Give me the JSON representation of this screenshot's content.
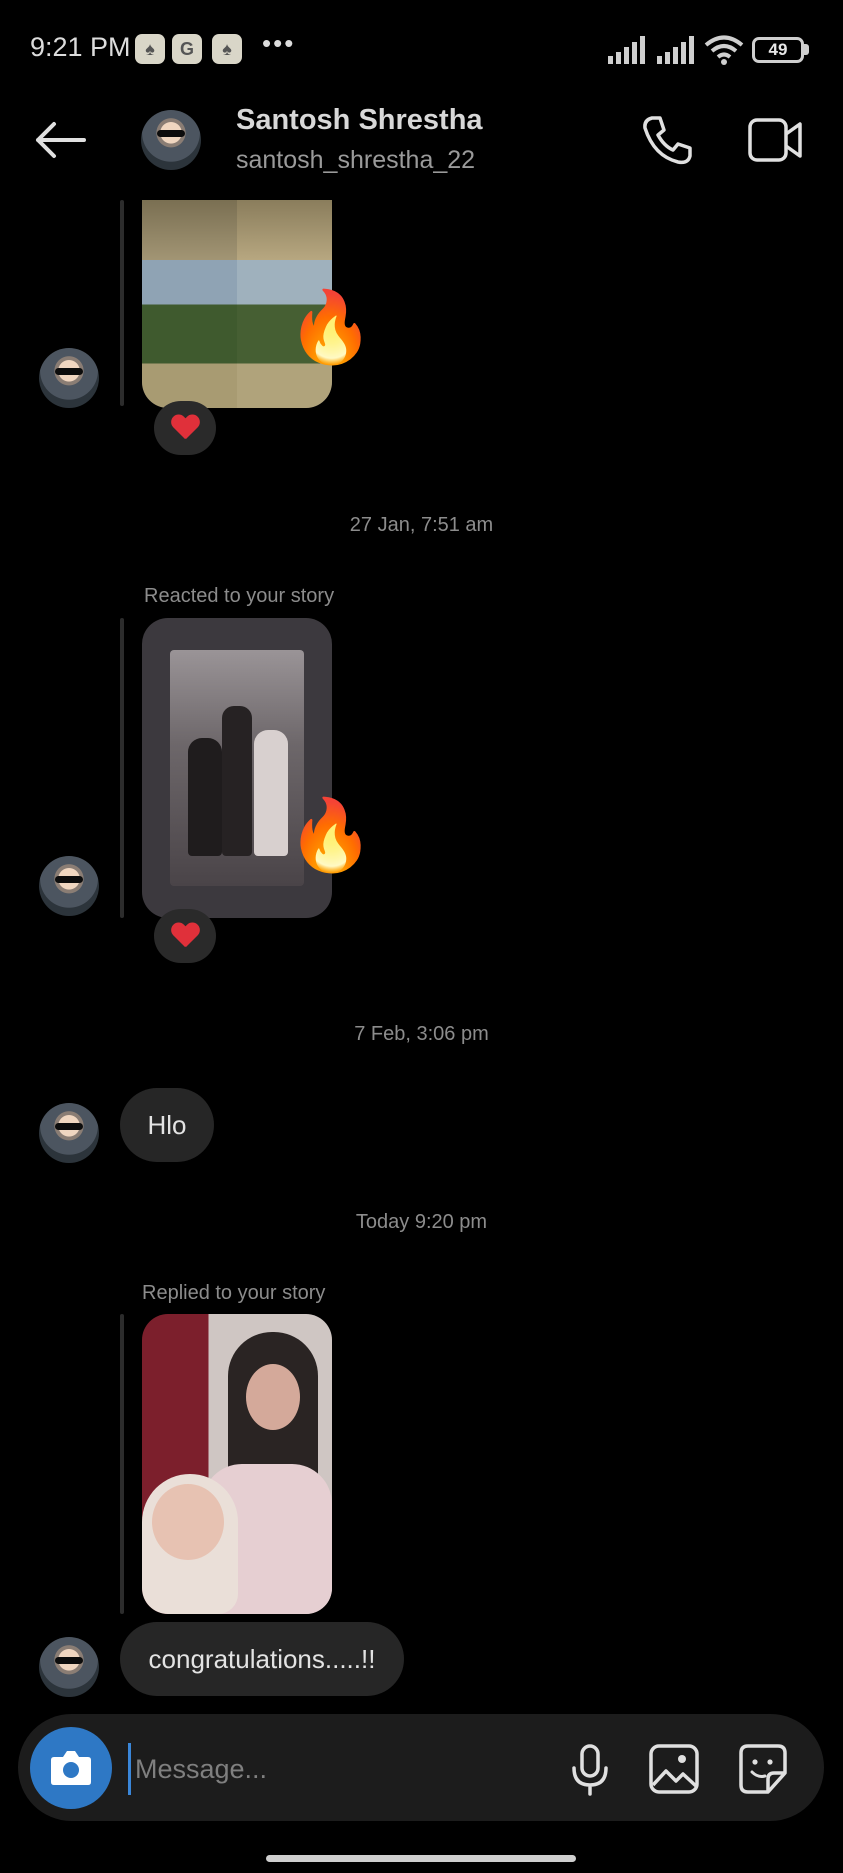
{
  "status_bar": {
    "time": "9:21 PM",
    "app_icons": [
      "snapchat-icon",
      "google-icon",
      "snapchat-icon"
    ],
    "more": "•••",
    "battery": "49"
  },
  "header": {
    "name": "Santosh Shrestha",
    "username": "santosh_shrestha_22"
  },
  "messages": {
    "timestamp_1": "27 Jan, 7:51 am",
    "reaction_caption": "Reacted to your story",
    "timestamp_2": "7 Feb, 3:06 pm",
    "text_1": "Hlo",
    "timestamp_3": "Today 9:20 pm",
    "reply_caption": "Replied to your story",
    "text_2": "congratulations.....!!",
    "reaction_emoji": "🔥"
  },
  "composer": {
    "placeholder": "Message..."
  },
  "colors": {
    "background": "#000000",
    "bubble": "#262626",
    "camera_button": "#2e78c5",
    "heart": "#e0303a"
  }
}
